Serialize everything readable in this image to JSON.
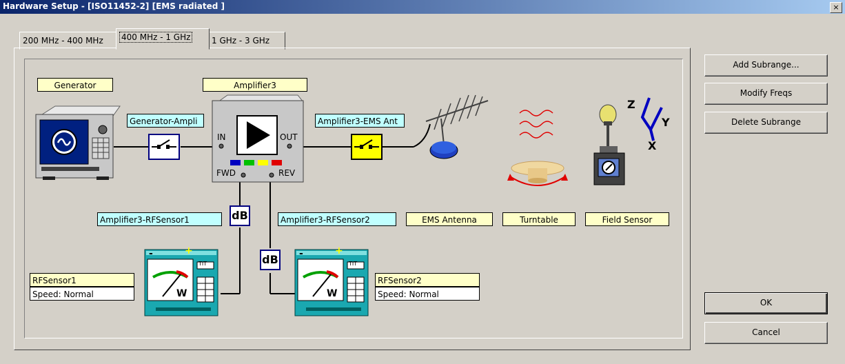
{
  "window": {
    "title": "Hardware Setup  -  [ISO11452-2] [EMS radiated ]",
    "close_glyph": "×"
  },
  "tabs": [
    {
      "label": "200 MHz - 400 MHz",
      "active": false
    },
    {
      "label": "400 MHz - 1 GHz",
      "active": true
    },
    {
      "label": "1 GHz - 3 GHz",
      "active": false
    }
  ],
  "diagram": {
    "generator_label": "Generator",
    "amplifier_label": "Amplifier3",
    "gen_amp_link": "Generator-Ampli",
    "amp_ant_link": "Amplifier3-EMS Ant",
    "amp_in": "IN",
    "amp_out": "OUT",
    "amp_fwd": "FWD",
    "amp_rev": "REV",
    "amp_sensor1_link": "Amplifier3-RFSensor1",
    "amp_sensor2_link": "Amplifier3-RFSensor2",
    "db_glyph": "dB",
    "ems_antenna_label": "EMS Antenna",
    "turntable_label": "Turntable",
    "field_sensor_label": "Field Sensor",
    "axes": {
      "z": "Z",
      "y": "Y",
      "x": "X"
    },
    "rfsensor1": {
      "name": "RFSensor1",
      "speed": "Speed: Normal"
    },
    "rfsensor2": {
      "name": "RFSensor2",
      "speed": "Speed: Normal"
    },
    "meter_glyphs": {
      "minus": "-",
      "plus": "+",
      "w": "W",
      "box": "TIT"
    }
  },
  "buttons": {
    "add_subrange": "Add Subrange...",
    "modify_freqs": "Modify Freqs",
    "delete_subrange": "Delete Subrange",
    "ok": "OK",
    "cancel": "Cancel"
  },
  "colors": {
    "title_start": "#0a246a",
    "title_end": "#a6caf0",
    "label_yellow": "#ffffc8",
    "label_cyan": "#c0ffff"
  }
}
